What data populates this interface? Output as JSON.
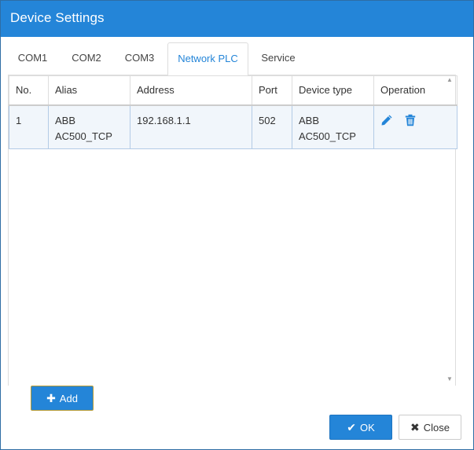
{
  "dialog": {
    "title": "Device Settings"
  },
  "tabs": [
    {
      "label": "COM1"
    },
    {
      "label": "COM2"
    },
    {
      "label": "COM3"
    },
    {
      "label": "Network PLC",
      "active": true
    },
    {
      "label": "Service"
    }
  ],
  "table": {
    "headers": {
      "no": "No.",
      "alias": "Alias",
      "address": "Address",
      "port": "Port",
      "device_type": "Device type",
      "operation": "Operation"
    },
    "rows": [
      {
        "no": "1",
        "alias_line1": "ABB",
        "alias_line2": "AC500_TCP",
        "address": "192.168.1.1",
        "port": "502",
        "device_type_line1": "ABB",
        "device_type_line2": "AC500_TCP",
        "operations": [
          "edit-icon",
          "delete-icon"
        ]
      }
    ]
  },
  "buttons": {
    "add_label": "Add",
    "ok_label": "OK",
    "close_label": "Close"
  },
  "colors": {
    "accent": "#2485d8",
    "row_highlight": "#f1f6fb"
  }
}
